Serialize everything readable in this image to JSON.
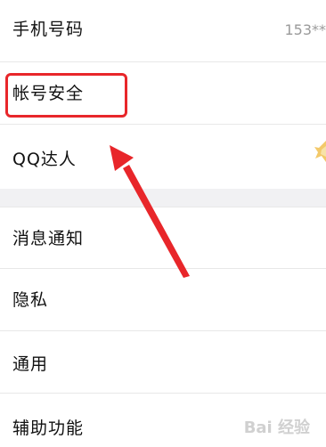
{
  "settings": {
    "phone": {
      "label": "手机号码",
      "value": "153**"
    },
    "account_security": {
      "label": "帐号安全"
    },
    "qq_expert": {
      "label": "QQ达人"
    },
    "notifications": {
      "label": "消息通知"
    },
    "privacy": {
      "label": "隐私"
    },
    "general": {
      "label": "通用"
    },
    "accessibility": {
      "label": "辅助功能"
    }
  },
  "annotation": {
    "highlight_color": "#e8262a"
  },
  "watermark": {
    "text": "Bai 经验"
  }
}
